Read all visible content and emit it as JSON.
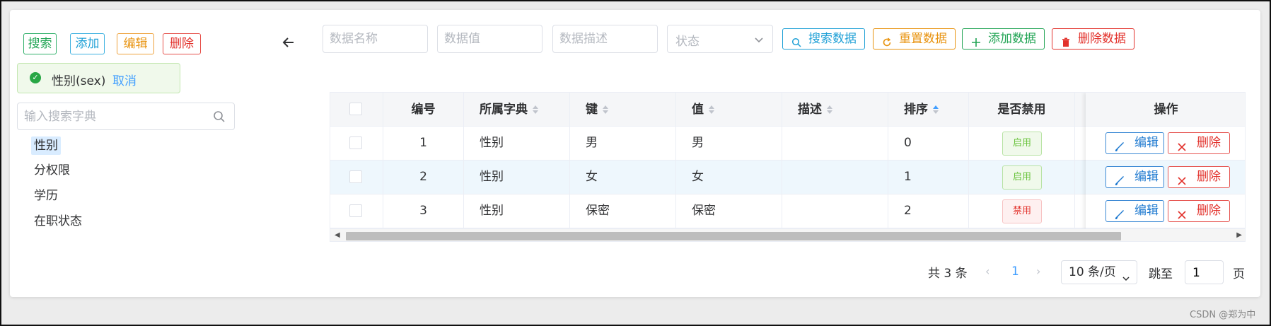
{
  "toolbar_left": {
    "search_label": "搜索",
    "add_label": "添加",
    "edit_label": "编辑",
    "delete_label": "删除"
  },
  "selected_dict": {
    "label": "性别(sex)",
    "cancel_label": "取消"
  },
  "dict_search": {
    "placeholder": "输入搜索字典"
  },
  "dict_tree": [
    {
      "label": "性别",
      "active": true
    },
    {
      "label": "分权限"
    },
    {
      "label": "学历"
    },
    {
      "label": "在职状态"
    }
  ],
  "filters": {
    "name_placeholder": "数据名称",
    "value_placeholder": "数据值",
    "desc_placeholder": "数据描述",
    "status_placeholder": "状态"
  },
  "actions": {
    "search_label": "搜索数据",
    "reset_label": "重置数据",
    "add_label": "添加数据",
    "delete_label": "删除数据"
  },
  "table": {
    "columns": {
      "id": "编号",
      "dict": "所属字典",
      "key": "键",
      "value": "值",
      "desc": "描述",
      "sort": "排序",
      "disabled": "是否禁用",
      "ops": "操作"
    },
    "rows": [
      {
        "id": "1",
        "dict": "性别",
        "key": "男",
        "value": "男",
        "desc": "",
        "sort": "0",
        "status": "启用"
      },
      {
        "id": "2",
        "dict": "性别",
        "key": "女",
        "value": "女",
        "desc": "",
        "sort": "1",
        "status": "启用"
      },
      {
        "id": "3",
        "dict": "性别",
        "key": "保密",
        "value": "保密",
        "desc": "",
        "sort": "2",
        "status": "禁用"
      }
    ],
    "edit_label": "编辑",
    "delete_label": "删除"
  },
  "pagination": {
    "total": "共 3 条",
    "current": "1",
    "page_size": "10 条/页",
    "goto_label": "跳至",
    "goto_value": "1",
    "page_suffix": "页"
  },
  "watermark": "CSDN @郑为中",
  "colors": {
    "green": "#21a454",
    "blue": "#1fa0d6",
    "orange": "#e8930f",
    "red": "#e2312b",
    "link": "#409eff"
  }
}
